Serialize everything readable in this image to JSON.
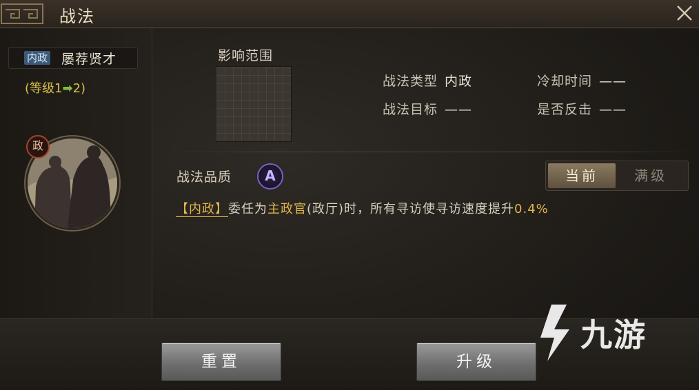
{
  "window": {
    "title": "战法"
  },
  "skill": {
    "type_tag": "内政",
    "name": "屡荐贤才",
    "level_prefix": "(等级1",
    "level_arrow": "➡",
    "level_suffix": "2)",
    "portrait_badge": "政"
  },
  "range": {
    "label": "影响范围"
  },
  "info": {
    "type_key": "战法类型",
    "type_val": "内政",
    "cooldown_key": "冷却时间",
    "cooldown_val": "——",
    "target_key": "战法目标",
    "target_val": "——",
    "counter_key": "是否反击",
    "counter_val": "——"
  },
  "quality": {
    "label": "战法品质",
    "grade": "A"
  },
  "tabs": {
    "current": "当前",
    "max": "满级"
  },
  "description": {
    "tag": "【内政】",
    "part1": "委任为",
    "highlight": "主政官",
    "part2": "(政厅)时，所有寻访使寻访速度提升",
    "value": "0.4%"
  },
  "buttons": {
    "reset": "重置",
    "upgrade": "升级"
  },
  "watermark": {
    "text": "九游"
  },
  "icons": {
    "close": "close-icon",
    "watermark_logo": "jiuyou-logo-icon"
  }
}
